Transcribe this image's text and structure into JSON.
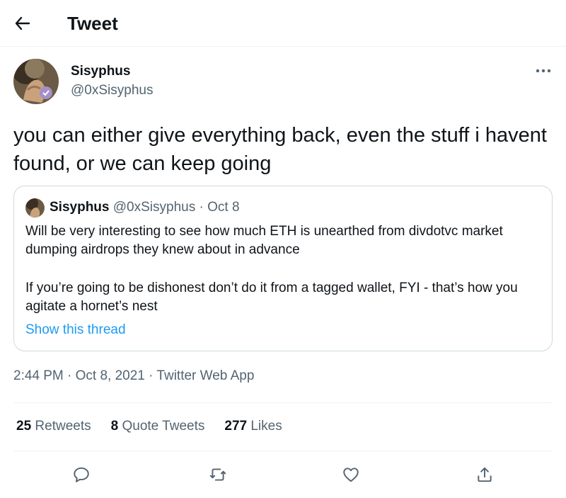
{
  "header": {
    "title": "Tweet"
  },
  "author": {
    "name": "Sisyphus",
    "handle": "@0xSisyphus"
  },
  "tweet": {
    "text": "you can either give everything back, even the stuff i havent found, or we can keep going",
    "timestamp": "2:44 PM · Oct 8, 2021 · Twitter Web App"
  },
  "quote": {
    "name": "Sisyphus",
    "handle": "@0xSisyphus",
    "separator": "·",
    "date": "Oct 8",
    "paragraph1": "Will be very interesting to see how much ETH is unearthed from divdotvc market dumping airdrops they knew about in advance",
    "paragraph2": "If you’re going to be dishonest don’t do it from a tagged wallet, FYI - that’s how you agitate a hornet’s nest",
    "show_thread": "Show this thread"
  },
  "stats": {
    "retweets": {
      "count": "25",
      "label": "Retweets"
    },
    "quote_tweets": {
      "count": "8",
      "label": "Quote Tweets"
    },
    "likes": {
      "count": "277",
      "label": "Likes"
    }
  },
  "actions": [
    "reply-icon",
    "retweet-icon",
    "like-icon",
    "share-icon"
  ],
  "colors": {
    "text": "#0f1419",
    "secondary": "#536471",
    "link": "#1d9bf0",
    "border": "#cfd9de",
    "divider": "#eff3f4"
  }
}
